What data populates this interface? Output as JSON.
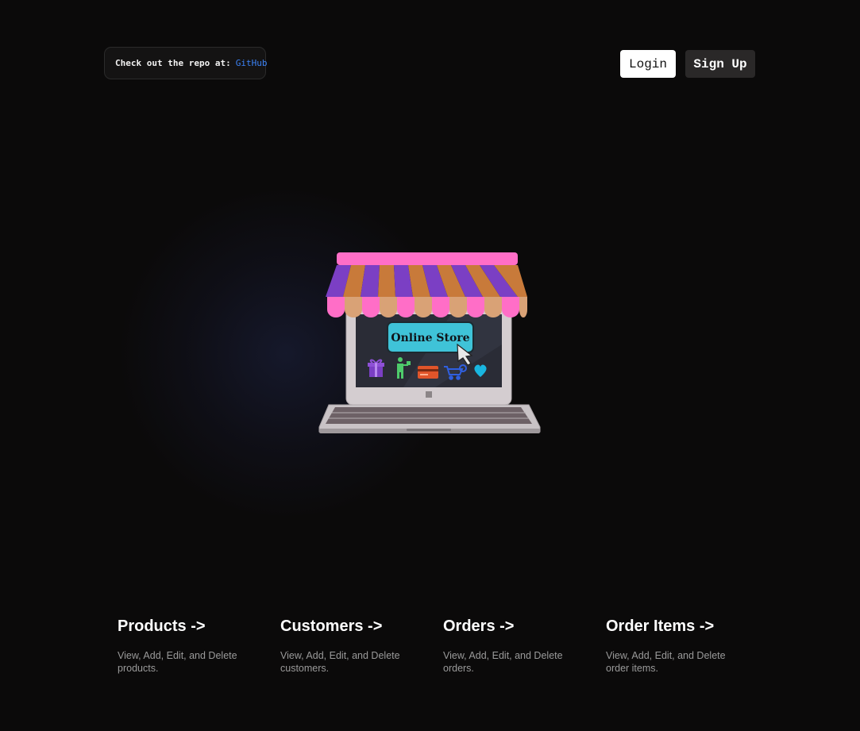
{
  "header": {
    "repo_text": "Check out the repo at:",
    "repo_link": "GitHub",
    "login_label": "Login",
    "signup_label": "Sign Up"
  },
  "hero": {
    "sign_text": "Online Store"
  },
  "cards": [
    {
      "title": "Products ->",
      "description": "View, Add, Edit, and Delete products."
    },
    {
      "title": "Customers ->",
      "description": "View, Add, Edit, and Delete customers."
    },
    {
      "title": "Orders ->",
      "description": "View, Add, Edit, and Delete orders."
    },
    {
      "title": "Order Items ->",
      "description": "View, Add, Edit, and Delete order items."
    }
  ],
  "colors": {
    "background": "#0b0a0a",
    "link": "#3b82f6",
    "awning_pink": "#ff6ec7",
    "awning_purple": "#7b3fc4",
    "awning_orange": "#c87a3a",
    "sign_blue": "#3fc3d8"
  }
}
